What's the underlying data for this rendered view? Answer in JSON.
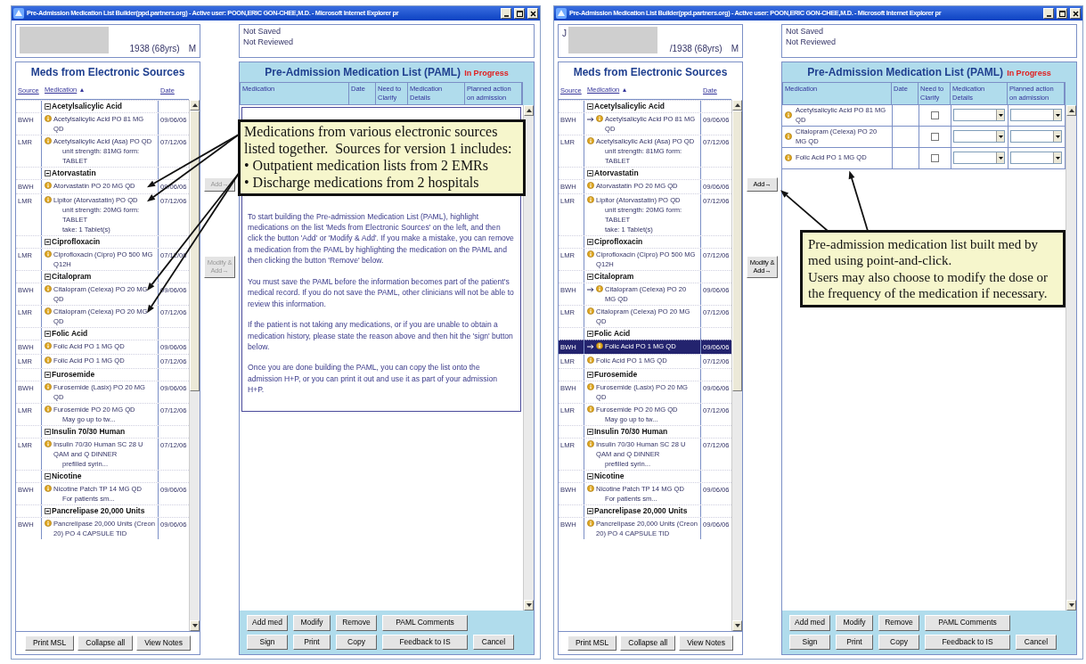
{
  "windows": [
    {
      "title": "Pre-Admission Medication List Builder(ppd.partners.org) - Active user: POON,ERIC GON-CHEE,M.D. - Microsoft Internet Explorer pr",
      "patient": {
        "birth": "1938 (68yrs)",
        "sex": "M"
      },
      "record_status": [
        "Not Saved",
        "Not Reviewed"
      ],
      "sources": {
        "title": "Meds from Electronic Sources",
        "columns": [
          "Source",
          "Medication",
          "Date"
        ],
        "sort_indicator": "▴",
        "groups": [
          {
            "name": "Acetylsalicylic Acid",
            "rows": [
              {
                "source": "BWH",
                "medication": "Acetylsalicylic Acid PO 81 MG QD",
                "date": "09/06/06",
                "added": false,
                "selected": false
              },
              {
                "source": "LMR",
                "medication": "Acetylsalicylic Acid (Asa) PO QD",
                "notes": [
                  "unit strength: 81MG form: TABLET"
                ],
                "date": "07/12/06",
                "added": false,
                "selected": false
              }
            ]
          },
          {
            "name": "Atorvastatin",
            "rows": [
              {
                "source": "BWH",
                "medication": "Atorvastatin PO 20 MG QD",
                "date": "09/06/06",
                "added": false,
                "selected": false,
                "pointer": true
              },
              {
                "source": "LMR",
                "medication": "Lipitor (Atorvastatin) PO QD",
                "notes": [
                  "unit strength: 20MG form: TABLET",
                  "take: 1 Tablet(s)"
                ],
                "date": "07/12/06",
                "added": false,
                "selected": false,
                "pointer": true
              }
            ]
          },
          {
            "name": "Ciprofloxacin",
            "rows": [
              {
                "source": "LMR",
                "medication": "Ciprofloxacin (Cipro) PO 500 MG Q12H",
                "date": "07/12/06",
                "added": false,
                "selected": false
              }
            ]
          },
          {
            "name": "Citalopram",
            "rows": [
              {
                "source": "BWH",
                "medication": "Citalopram (Celexa) PO 20 MG QD",
                "date": "09/06/06",
                "added": false,
                "selected": false,
                "pointer": true
              },
              {
                "source": "LMR",
                "medication": "Citalopram (Celexa) PO 20 MG QD",
                "date": "07/12/06",
                "added": false,
                "selected": false,
                "pointer": true
              }
            ]
          },
          {
            "name": "Folic Acid",
            "rows": [
              {
                "source": "BWH",
                "medication": "Folic Acid PO 1 MG QD",
                "date": "09/06/06",
                "added": false,
                "selected": false
              },
              {
                "source": "LMR",
                "medication": "Folic Acid PO 1 MG QD",
                "date": "07/12/06",
                "added": false,
                "selected": false
              }
            ]
          },
          {
            "name": "Furosemide",
            "rows": [
              {
                "source": "BWH",
                "medication": "Furosemide (Lasix) PO 20 MG QD",
                "date": "09/06/06",
                "added": false,
                "selected": false
              },
              {
                "source": "LMR",
                "medication": "Furosemide PO 20 MG QD",
                "notes": [
                  "May go up to tw..."
                ],
                "date": "07/12/06",
                "added": false,
                "selected": false
              }
            ]
          },
          {
            "name": "Insulin 70/30 Human",
            "rows": [
              {
                "source": "LMR",
                "medication": "Insulin 70/30 Human SC 28 U QAM and Q DINNER",
                "notes": [
                  "prefilled syrin..."
                ],
                "date": "07/12/06",
                "added": false,
                "selected": false
              }
            ]
          },
          {
            "name": "Nicotine",
            "rows": [
              {
                "source": "BWH",
                "medication": "Nicotine Patch TP 14 MG QD",
                "notes": [
                  "For patients sm..."
                ],
                "date": "09/06/06",
                "added": false,
                "selected": false
              }
            ]
          },
          {
            "name": "Pancrelipase 20,000 Units",
            "rows": [
              {
                "source": "BWH",
                "medication": "Pancrelipase 20,000 Units (Creon 20) PO 4 CAPSULE TID",
                "date": "09/06/06",
                "added": false,
                "selected": false
              }
            ]
          }
        ],
        "buttons": [
          "Print MSL",
          "Collapse all",
          "View Notes"
        ]
      },
      "transfer_buttons": [
        {
          "label": "Add→",
          "disabled": true
        },
        {
          "label": "Modify & Add→",
          "disabled": true
        }
      ],
      "paml": {
        "title": "Pre-Admission Medication List (PAML)",
        "status": "In Progress",
        "columns": [
          "Medication",
          "Date",
          "Need to Clarify",
          "Medication Details",
          "Planned action on admission"
        ],
        "instructions": [
          "To start building the Pre-admission Medication List (PAML), highlight medications on the list 'Meds from Electronic Sources' on the left, and then click the button 'Add' or 'Modify & Add'. If you make a mistake, you can remove a medication from the PAML by highlighting the medication on the PAML and then clicking the button 'Remove' below.",
          "You must save the PAML before the information becomes part of the patient's medical record. If you do not save the PAML, other clinicians will not be able to review this information.",
          "If the patient is not taking any medications, or if you are unable to obtain a medication history, please state the reason above and then hit the 'sign' button below.",
          "Once you are done building the PAML, you can copy the list onto the admission H+P, or you can print it out and use it as part of your admission H+P."
        ],
        "buttons": [
          [
            "Add med",
            "Modify",
            "Remove",
            "PAML Comments"
          ],
          [
            "Sign",
            "Print",
            "Copy",
            "Feedback to IS",
            "Cancel"
          ]
        ]
      },
      "callout": {
        "kind": "side",
        "paragraphs": [
          "Medications from various electronic sources listed together.  Sources for version 1 includes:",
          "• Outpatient medication lists from 2 EMRs",
          "• Discharge medications from 2 hospitals"
        ]
      }
    },
    {
      "title": "Pre-Admission Medication List Builder(ppd.partners.org) - Active user: POON,ERIC GON-CHEE,M.D. - Microsoft Internet Explorer pr",
      "patient": {
        "name": "J",
        "birth": "/1938 (68yrs)",
        "sex": "M"
      },
      "record_status": [
        "Not Saved",
        "Not Reviewed"
      ],
      "sources": {
        "title": "Meds from Electronic Sources",
        "columns": [
          "Source",
          "Medication",
          "Date"
        ],
        "sort_indicator": "▴",
        "groups": [
          {
            "name": "Acetylsalicylic Acid",
            "rows": [
              {
                "source": "BWH",
                "medication": "Acetylsalicylic Acid PO 81 MG QD",
                "date": "09/06/06",
                "added": true,
                "selected": false
              },
              {
                "source": "LMR",
                "medication": "Acetylsalicylic Acid (Asa) PO QD",
                "notes": [
                  "unit strength: 81MG form: TABLET"
                ],
                "date": "07/12/06",
                "added": false,
                "selected": false
              }
            ]
          },
          {
            "name": "Atorvastatin",
            "rows": [
              {
                "source": "BWH",
                "medication": "Atorvastatin PO 20 MG QD",
                "date": "09/06/06",
                "added": false,
                "selected": false
              },
              {
                "source": "LMR",
                "medication": "Lipitor (Atorvastatin) PO QD",
                "notes": [
                  "unit strength: 20MG form: TABLET",
                  "take: 1 Tablet(s)"
                ],
                "date": "07/12/06",
                "added": false,
                "selected": false
              }
            ]
          },
          {
            "name": "Ciprofloxacin",
            "rows": [
              {
                "source": "LMR",
                "medication": "Ciprofloxacin (Cipro) PO 500 MG Q12H",
                "date": "07/12/06",
                "added": false,
                "selected": false
              }
            ]
          },
          {
            "name": "Citalopram",
            "rows": [
              {
                "source": "BWH",
                "medication": "Citalopram (Celexa) PO 20 MG QD",
                "date": "09/06/06",
                "added": true,
                "selected": false
              },
              {
                "source": "LMR",
                "medication": "Citalopram (Celexa) PO 20 MG QD",
                "date": "07/12/06",
                "added": false,
                "selected": false
              }
            ]
          },
          {
            "name": "Folic Acid",
            "rows": [
              {
                "source": "BWH",
                "medication": "Folic Acid PO 1 MG QD",
                "date": "09/06/06",
                "added": true,
                "selected": true
              },
              {
                "source": "LMR",
                "medication": "Folic Acid PO 1 MG QD",
                "date": "07/12/06",
                "added": false,
                "selected": false
              }
            ]
          },
          {
            "name": "Furosemide",
            "rows": [
              {
                "source": "BWH",
                "medication": "Furosemide (Lasix) PO 20 MG QD",
                "date": "09/06/06",
                "added": false,
                "selected": false
              },
              {
                "source": "LMR",
                "medication": "Furosemide PO 20 MG QD",
                "notes": [
                  "May go up to tw..."
                ],
                "date": "07/12/06",
                "added": false,
                "selected": false
              }
            ]
          },
          {
            "name": "Insulin 70/30 Human",
            "rows": [
              {
                "source": "LMR",
                "medication": "Insulin 70/30 Human SC 28 U QAM and Q DINNER",
                "notes": [
                  "prefilled syrin..."
                ],
                "date": "07/12/06",
                "added": false,
                "selected": false
              }
            ]
          },
          {
            "name": "Nicotine",
            "rows": [
              {
                "source": "BWH",
                "medication": "Nicotine Patch TP 14 MG QD",
                "notes": [
                  "For patients sm..."
                ],
                "date": "09/06/06",
                "added": false,
                "selected": false
              }
            ]
          },
          {
            "name": "Pancrelipase 20,000 Units",
            "rows": [
              {
                "source": "BWH",
                "medication": "Pancrelipase 20,000 Units (Creon 20) PO 4 CAPSULE TID",
                "date": "09/06/06",
                "added": false,
                "selected": false
              }
            ]
          }
        ],
        "buttons": [
          "Print MSL",
          "Collapse all",
          "View Notes"
        ]
      },
      "transfer_buttons": [
        {
          "label": "Add→",
          "disabled": false,
          "pointer": true
        },
        {
          "label": "Modify & Add→",
          "disabled": false
        }
      ],
      "paml": {
        "title": "Pre-Admission Medication List (PAML)",
        "status": "In Progress",
        "columns": [
          "Medication",
          "Date",
          "Need to Clarify",
          "Medication Details",
          "Planned action on admission"
        ],
        "rows": [
          {
            "medication": "Acetylsalicylic Acid PO 81 MG QD",
            "clarify": false
          },
          {
            "medication": "Citalopram (Celexa) PO 20 MG QD",
            "clarify": false
          },
          {
            "medication": "Folic Acid PO 1 MG QD",
            "clarify": false,
            "pointer": true
          }
        ],
        "buttons": [
          [
            "Add med",
            "Modify",
            "Remove",
            "PAML Comments"
          ],
          [
            "Sign",
            "Print",
            "Copy",
            "Feedback to IS",
            "Cancel"
          ]
        ]
      },
      "callout": {
        "kind": "top",
        "paragraphs": [
          "Pre-admission medication list built med by med using point-and-click.",
          "Users may also choose to modify the dose or the frequency of the medication if necessary."
        ]
      }
    }
  ]
}
